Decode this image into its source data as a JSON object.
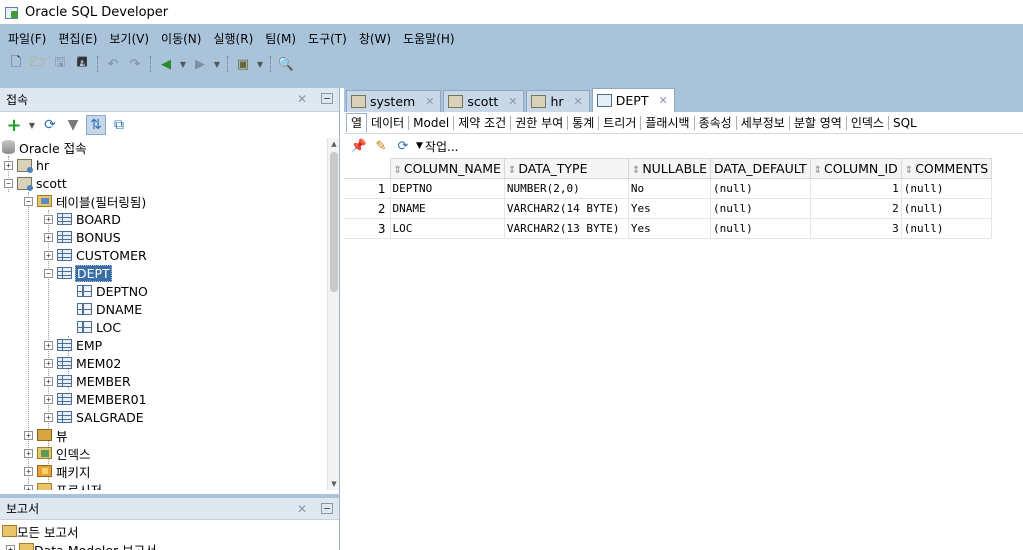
{
  "window": {
    "title": "Oracle SQL Developer"
  },
  "menu": [
    "파일(F)",
    "편집(E)",
    "보기(V)",
    "이동(N)",
    "실행(R)",
    "팀(M)",
    "도구(T)",
    "창(W)",
    "도움말(H)"
  ],
  "connections_panel": {
    "title": "접속",
    "tree": {
      "root": "Oracle 접속",
      "hr": "hr",
      "scott": "scott",
      "tables_folder": "테이블(필터링됨)",
      "tables": [
        "BOARD",
        "BONUS",
        "CUSTOMER",
        "DEPT"
      ],
      "dept_columns": [
        "DEPTNO",
        "DNAME",
        "LOC"
      ],
      "tables_after": [
        "EMP",
        "MEM02",
        "MEMBER",
        "MEMBER01",
        "SALGRADE"
      ],
      "folders": [
        "뷰",
        "인덱스",
        "패키지",
        "프로시저"
      ]
    }
  },
  "reports_panel": {
    "title": "보고서",
    "items": [
      "모든 보고서",
      "Data Modeler 보고서"
    ]
  },
  "editor": {
    "tabs": [
      {
        "label": "system",
        "icon": "connection-icon"
      },
      {
        "label": "scott",
        "icon": "connection-icon"
      },
      {
        "label": "hr",
        "icon": "connection-icon"
      },
      {
        "label": "DEPT",
        "icon": "table-icon"
      }
    ],
    "sub_tabs": [
      "열",
      "데이터",
      "Model",
      "제약 조건",
      "권한 부여",
      "통계",
      "트리거",
      "플래시백",
      "종속성",
      "세부정보",
      "분할 영역",
      "인덱스",
      "SQL"
    ],
    "action_label": "작업...",
    "columns": [
      "COLUMN_NAME",
      "DATA_TYPE",
      "NULLABLE",
      "DATA_DEFAULT",
      "COLUMN_ID",
      "COMMENTS"
    ],
    "rows": [
      {
        "n": "1",
        "COLUMN_NAME": "DEPTNO",
        "DATA_TYPE": "NUMBER(2,0)",
        "NULLABLE": "No",
        "DATA_DEFAULT": "(null)",
        "COLUMN_ID": "1",
        "COMMENTS": "(null)"
      },
      {
        "n": "2",
        "COLUMN_NAME": "DNAME",
        "DATA_TYPE": "VARCHAR2(14 BYTE)",
        "NULLABLE": "Yes",
        "DATA_DEFAULT": "(null)",
        "COLUMN_ID": "2",
        "COMMENTS": "(null)"
      },
      {
        "n": "3",
        "COLUMN_NAME": "LOC",
        "DATA_TYPE": "VARCHAR2(13 BYTE)",
        "NULLABLE": "Yes",
        "DATA_DEFAULT": "(null)",
        "COLUMN_ID": "3",
        "COMMENTS": "(null)"
      }
    ]
  },
  "colors": {
    "chrome": "#a9c3db",
    "selection": "#3a6ea5"
  }
}
